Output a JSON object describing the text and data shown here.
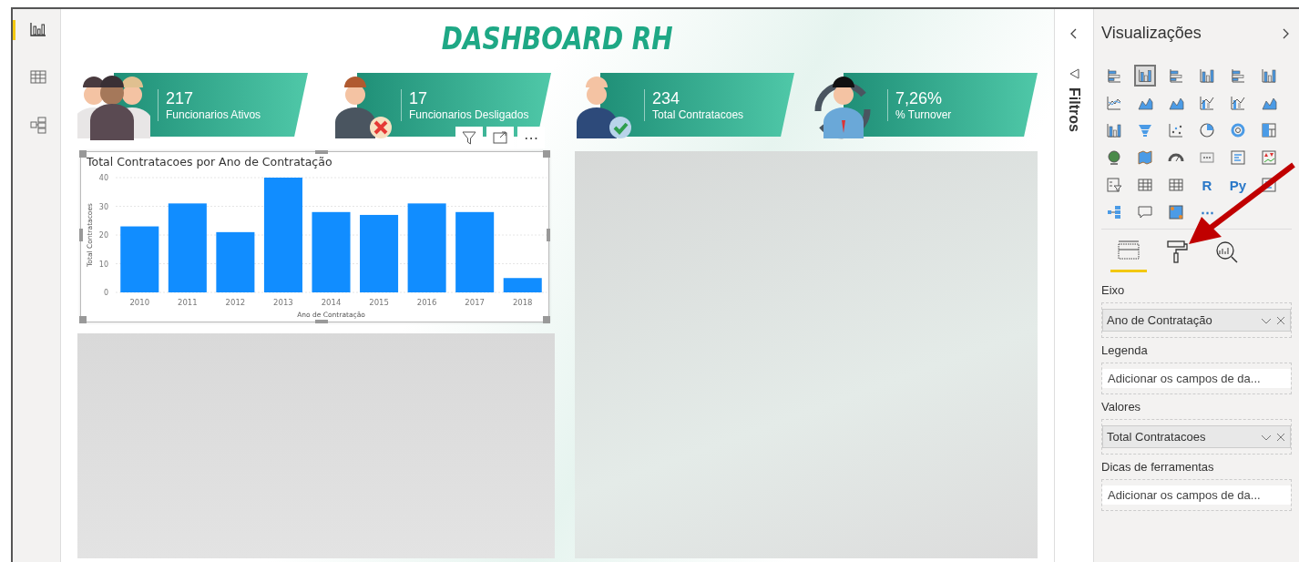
{
  "nav": [
    {
      "kind": "report",
      "selected": true
    },
    {
      "kind": "data",
      "selected": false
    },
    {
      "kind": "model",
      "selected": false
    }
  ],
  "title": "DASHBOARD RH",
  "kpis": [
    {
      "kind": "group",
      "value": "217",
      "label": "Funcionarios Ativos"
    },
    {
      "kind": "removed",
      "value": "17",
      "label": "Funcionarios Desligados"
    },
    {
      "kind": "hired",
      "value": "234",
      "label": "Total Contratacoes"
    },
    {
      "kind": "turnover",
      "value": "7,26%",
      "label": "% Turnover"
    }
  ],
  "visual_header": {
    "more": "⋯"
  },
  "chart": {
    "chart_data": {
      "type": "bar",
      "title": "Total Contratacoes por Ano de Contratação",
      "xlabel": "Ano de Contratação",
      "ylabel": "Total Contratacoes",
      "categories": [
        "2010",
        "2011",
        "2012",
        "2013",
        "2014",
        "2015",
        "2016",
        "2017",
        "2018"
      ],
      "grid": true,
      "series": [
        {
          "color": "#118dff",
          "values": [
            23,
            31,
            21,
            40,
            28,
            27,
            31,
            28,
            5
          ]
        }
      ],
      "ylim": [
        0,
        40
      ],
      "yticks": [
        0,
        10,
        20,
        30,
        40
      ]
    }
  },
  "filters": {
    "label": "Filtros"
  },
  "visualizations": {
    "title": "Visualizações",
    "types": [
      {
        "kind": "hbar",
        "selected": false
      },
      {
        "kind": "vbar",
        "selected": true
      },
      {
        "kind": "hbar",
        "selected": false
      },
      {
        "kind": "vbar",
        "selected": false
      },
      {
        "kind": "hbar",
        "selected": false
      },
      {
        "kind": "vbar",
        "selected": false
      },
      {
        "kind": "line",
        "selected": false
      },
      {
        "kind": "area",
        "selected": false
      },
      {
        "kind": "area",
        "selected": false
      },
      {
        "kind": "combo",
        "selected": false
      },
      {
        "kind": "combo",
        "selected": false
      },
      {
        "kind": "area",
        "selected": false
      },
      {
        "kind": "vbar",
        "selected": false
      },
      {
        "kind": "funnel",
        "selected": false
      },
      {
        "kind": "scatter",
        "selected": false
      },
      {
        "kind": "pie",
        "selected": false
      },
      {
        "kind": "donut",
        "selected": false
      },
      {
        "kind": "treemap",
        "selected": false
      },
      {
        "kind": "globe",
        "selected": false
      },
      {
        "kind": "map",
        "selected": false
      },
      {
        "kind": "gauge",
        "selected": false
      },
      {
        "kind": "card",
        "selected": false
      },
      {
        "kind": "list",
        "selected": false
      },
      {
        "kind": "kpi",
        "selected": false
      },
      {
        "kind": "slicer",
        "selected": false
      },
      {
        "kind": "table",
        "selected": false
      },
      {
        "kind": "table",
        "selected": false
      },
      {
        "kind": "letter",
        "label": "R",
        "selected": false
      },
      {
        "kind": "letter",
        "label": "Py",
        "selected": false
      },
      {
        "kind": "list",
        "selected": false
      },
      {
        "kind": "tree",
        "selected": false
      },
      {
        "kind": "speech",
        "selected": false
      },
      {
        "kind": "custom",
        "selected": false
      },
      {
        "kind": "more",
        "label": "⋯",
        "selected": false
      }
    ],
    "tabs": [
      {
        "kind": "fields",
        "selected": true
      },
      {
        "kind": "format",
        "selected": false
      },
      {
        "kind": "analytics",
        "selected": false
      }
    ],
    "wells": [
      {
        "label": "Eixo",
        "value": "Ano de Contratação"
      },
      {
        "label": "Legenda",
        "placeholder": "Adicionar os campos de da..."
      },
      {
        "label": "Valores",
        "value": "Total Contratacoes"
      },
      {
        "label": "Dicas de ferramentas",
        "placeholder": "Adicionar os campos de da..."
      }
    ]
  }
}
